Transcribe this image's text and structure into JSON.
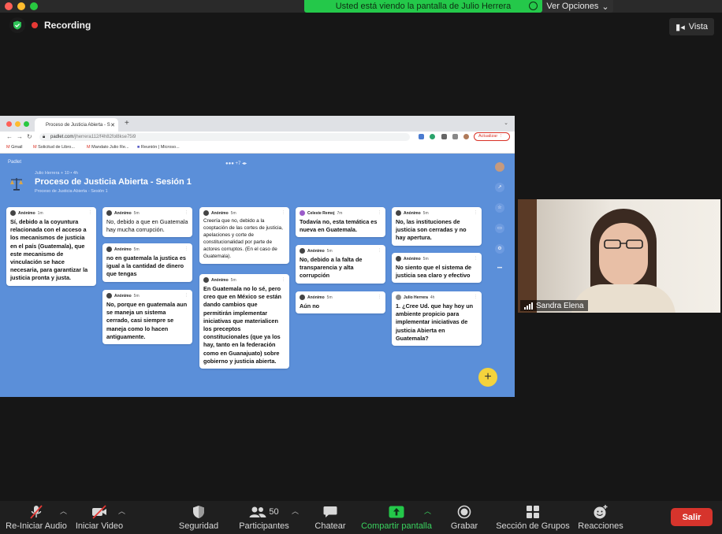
{
  "zoom": {
    "share_banner": "Usted está viendo la pantalla de Julio Herrera",
    "view_options": "Ver Opciones",
    "recording": "Recording",
    "view_button": "Vista",
    "participant_name": "Sandra Elena",
    "participants_count": "50",
    "toolbar": {
      "audio": "Re-Iniciar Audio",
      "video": "Iniciar Video",
      "security": "Seguridad",
      "participants": "Participantes",
      "chat": "Chatear",
      "share": "Compartir pantalla",
      "record": "Grabar",
      "breakout": "Sección de Grupos",
      "reactions": "Reacciones",
      "leave": "Salir"
    },
    "colors": {
      "share_green": "#24c84a",
      "leave_red": "#d6342c",
      "padlet_blue": "#5b8fd9"
    }
  },
  "browser": {
    "tab_title": "Proceso de Justicia Abierta - S",
    "url_domain": "padlet.com",
    "url_path": "/jherrera112/f4h82fol8kse75i9",
    "update_button": "Actualizar",
    "bookmarks": [
      "Gmail",
      "Solicitud de Libro...",
      "Mandato Julio Re...",
      "Reunión | Microso..."
    ]
  },
  "padlet": {
    "logo": "Padlet",
    "author_line": "Julio Herrera + 10 • 4h",
    "title": "Proceso de Justicia Abierta - Sesión 1",
    "subtitle": "Proceso de Justicia Abierta - Sesión 1",
    "avatars_extra": "+7",
    "cards": [
      {
        "author": "Anónimo",
        "time": "1m",
        "text": "Sí, debido a la coyuntura relacionada con el acceso a los mecanismos de justicia en el país (Guatemala), que este mecanismo de vinculación se hace necesaria, para garantizar la justicia pronta y justa."
      },
      {
        "author": "Anónimo",
        "time": "5m",
        "text": "No, debido a que en Guatemala hay mucha corrupción."
      },
      {
        "author": "Anónimo",
        "time": "5m",
        "text": "no en guatemala la justica es igual a la cantidad de dinero que tengas"
      },
      {
        "author": "Anónimo",
        "time": "5m",
        "text": "No, porque en guatemala aun se maneja un sistema cerrado, casi siempre se maneja como lo hacen antiguamente."
      },
      {
        "author": "Anónimo",
        "time": "5m",
        "text": "Creería que no, debido a la cooptación de las cortes de justicia, apelaciones y corte de constitucionalidad por parte de actores corruptos. (En el caso de Guatemala)."
      },
      {
        "author": "Anónimo",
        "time": "5m",
        "text": "En Guatemala no lo sé, pero creo que en México se están dando cambios que permitirán implementar iniciativas que materialicen los preceptos constitucionales (que ya los hay, tanto en la federación como en Guanajuato) sobre gobierno y justicia abierta."
      },
      {
        "author": "Celeste Remoj",
        "time": "7m",
        "text": "Todavía no, esta temática es nueva en Guatemala."
      },
      {
        "author": "Anónimo",
        "time": "5m",
        "text": "No, debido a la falta de transparencia y alta corrupción"
      },
      {
        "author": "Anónimo",
        "time": "5m",
        "text": "Aún no"
      },
      {
        "author": "Anónimo",
        "time": "5m",
        "text": "No, las instituciones de justicia son cerradas y no hay apertura."
      },
      {
        "author": "Anónimo",
        "time": "5m",
        "text": "No siento que el sistema de justicia sea claro y efectivo"
      },
      {
        "author": "Julio Herrera",
        "time": "4h",
        "text": "1. ¿Cree Ud. que hay hoy un ambiente propicio para implementar iniciativas de justicia Abierta en Guatemala?"
      }
    ]
  }
}
